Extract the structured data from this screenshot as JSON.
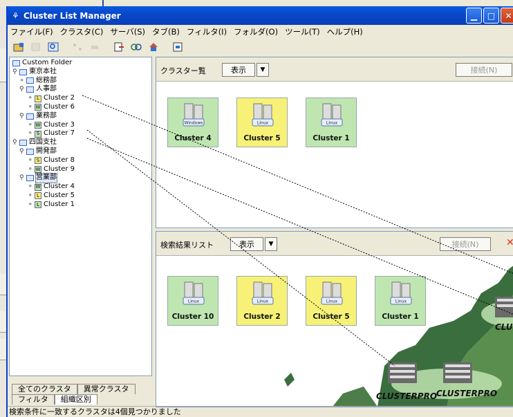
{
  "app": {
    "title": "Cluster List Manager"
  },
  "menu": [
    "ファイル(F)",
    "クラスタ(C)",
    "サーバ(S)",
    "タブ(B)",
    "フィルタ(I)",
    "フォルダ(O)",
    "ツール(T)",
    "ヘルプ(H)"
  ],
  "tree": {
    "root": "Custom Folder",
    "nodes": [
      {
        "label": "東京本社"
      },
      {
        "label": "総務部"
      },
      {
        "label": "人事部"
      },
      {
        "label": "Cluster 2",
        "badge": "L"
      },
      {
        "label": "Cluster 6",
        "badge": "W"
      },
      {
        "label": "業務部"
      },
      {
        "label": "Cluster 3",
        "badge": "W"
      },
      {
        "label": "Cluster 7",
        "badge": "S"
      },
      {
        "label": "四国支社"
      },
      {
        "label": "開発部"
      },
      {
        "label": "Cluster 8",
        "badge": "S"
      },
      {
        "label": "Cluster 9",
        "badge": "W"
      },
      {
        "label": "営業部"
      },
      {
        "label": "Cluster 4",
        "badge": "W"
      },
      {
        "label": "Cluster 5",
        "badge": "L"
      },
      {
        "label": "Cluster 1",
        "badge": "L"
      }
    ]
  },
  "left_tabs": {
    "all": "全てのクラスタ",
    "abnormal": "異常クラスタ",
    "filter": "フィルタ",
    "org": "組織区別"
  },
  "top_panel": {
    "title": "クラスター覧",
    "view_button": "表示",
    "connect_button": "接続(N)",
    "tiles": [
      {
        "name": "Cluster 4",
        "os": "Windows",
        "color": "#bfe6b0"
      },
      {
        "name": "Cluster 5",
        "os": "Linux",
        "color": "#f7f277"
      },
      {
        "name": "Cluster 1",
        "os": "Linux",
        "color": "#bfe6b0"
      }
    ]
  },
  "bottom_panel": {
    "title": "検索結果リスト",
    "view_button": "表示",
    "connect_button": "接続(N)",
    "close_glyph": "✕",
    "tiles": [
      {
        "name": "Cluster 10",
        "os": "Linux",
        "color": "#bfe6b0"
      },
      {
        "name": "Cluster 2",
        "os": "Linux",
        "color": "#f7f277"
      },
      {
        "name": "Cluster 5",
        "os": "Linux",
        "color": "#f7f277"
      },
      {
        "name": "Cluster 1",
        "os": "Linux",
        "color": "#bfe6b0"
      }
    ],
    "map_labels": [
      "CLUSTERPRO",
      "CLUSTERPRO",
      "CLUST"
    ]
  },
  "status": "検索条件に一致するクラスタは4個見つかりました"
}
